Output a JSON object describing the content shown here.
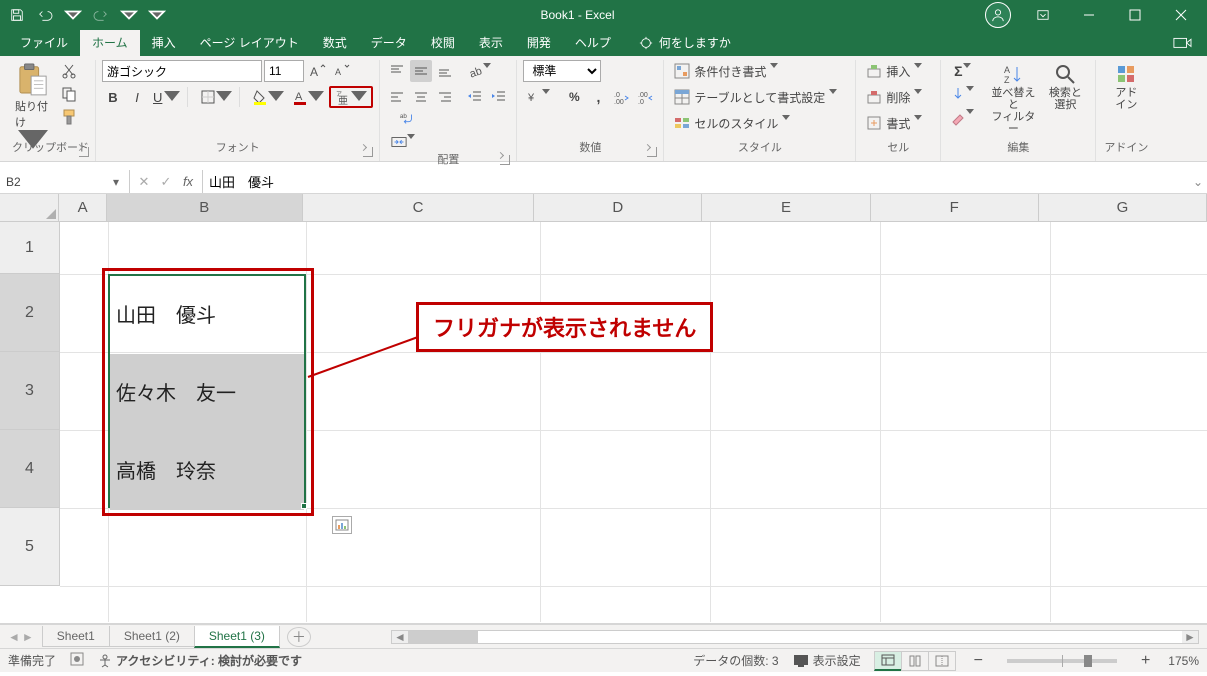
{
  "title": "Book1 - Excel",
  "tabs": {
    "file": "ファイル",
    "home": "ホーム",
    "insert": "挿入",
    "pagelayout": "ページ レイアウト",
    "formulas": "数式",
    "data": "データ",
    "review": "校閲",
    "view": "表示",
    "developer": "開発",
    "help": "ヘルプ",
    "tellme": "何をしますか"
  },
  "ribbon": {
    "clipboard": {
      "paste": "貼り付け",
      "label": "クリップボード"
    },
    "font": {
      "name": "游ゴシック",
      "size": "11",
      "label": "フォント"
    },
    "alignment": {
      "label": "配置"
    },
    "number": {
      "format": "標準",
      "label": "数値"
    },
    "styles": {
      "cond": "条件付き書式",
      "table": "テーブルとして書式設定",
      "cell": "セルのスタイル",
      "label": "スタイル"
    },
    "cells": {
      "insert": "挿入",
      "delete": "削除",
      "format": "書式",
      "label": "セル"
    },
    "editing": {
      "sort": "並べ替えと\nフィルター",
      "find": "検索と\n選択",
      "label": "編集"
    },
    "addin": {
      "addin": "アド\nイン",
      "label": "アドイン"
    }
  },
  "namebox": "B2",
  "formula": "山田　優斗",
  "columns": [
    "A",
    "B",
    "C",
    "D",
    "E",
    "F",
    "G"
  ],
  "rows": [
    "1",
    "2",
    "3",
    "4",
    "5"
  ],
  "cells": {
    "B2": "山田　優斗",
    "B3": "佐々木　友一",
    "B4": "高橋　玲奈"
  },
  "callout": "フリガナが表示されません",
  "sheets": {
    "s1": "Sheet1",
    "s2": "Sheet1 (2)",
    "s3": "Sheet1 (3)"
  },
  "status": {
    "ready": "準備完了",
    "access": "アクセシビリティ: 検討が必要です",
    "count": "データの個数: 3",
    "dispset": "表示設定",
    "zoom": "175%"
  }
}
